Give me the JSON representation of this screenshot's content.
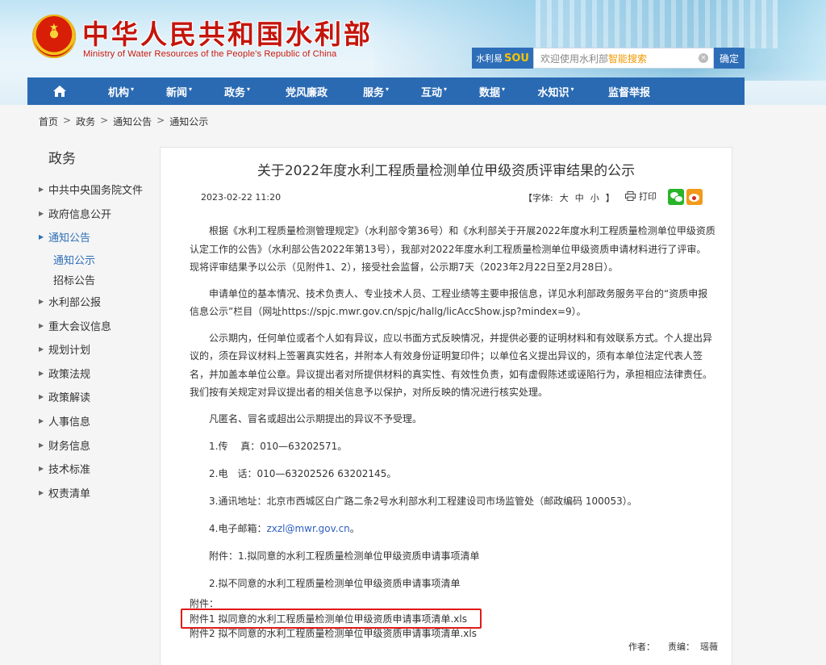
{
  "header": {
    "site_title_cn": "中华人民共和国水利部",
    "site_title_en": "Ministry of Water Resources of the People's Republic of China",
    "search": {
      "brand_prefix": "水利易",
      "brand_logo": "SOU",
      "placeholder_prefix": "欢迎使用水利部",
      "placeholder_highlight": "智能搜索",
      "button_label": "确定"
    }
  },
  "nav": {
    "items": [
      "机构",
      "新闻",
      "政务",
      "党风廉政",
      "服务",
      "互动",
      "数据",
      "水知识",
      "监督举报"
    ],
    "carets": [
      true,
      true,
      true,
      false,
      true,
      true,
      true,
      true,
      false
    ]
  },
  "breadcrumb": [
    "首页",
    "政务",
    "通知公告",
    "通知公示"
  ],
  "sidebar": {
    "title": "政务",
    "items": [
      {
        "label": "中共中央国务院文件"
      },
      {
        "label": "政府信息公开"
      },
      {
        "label": "通知公告"
      },
      {
        "label": "通知公示"
      },
      {
        "label": "招标公告"
      },
      {
        "label": "水利部公报"
      },
      {
        "label": "重大会议信息"
      },
      {
        "label": "规划计划"
      },
      {
        "label": "政策法规"
      },
      {
        "label": "政策解读"
      },
      {
        "label": "人事信息"
      },
      {
        "label": "财务信息"
      },
      {
        "label": "技术标准"
      },
      {
        "label": "权责清单"
      }
    ]
  },
  "article": {
    "title": "关于2022年度水利工程质量检测单位甲级资质评审结果的公示",
    "date": "2023-02-22 11:20",
    "font_label": "【字体:",
    "font_sizes": [
      "大",
      "中",
      "小"
    ],
    "font_close": "】",
    "print_label": "打印",
    "paragraphs": [
      "根据《水利工程质量检测管理规定》（水利部令第36号）和《水利部关于开展2022年度水利工程质量检测单位甲级资质认定工作的公告》（水利部公告2022年第13号），我部对2022年度水利工程质量检测单位甲级资质申请材料进行了评审。现将评审结果予以公示（见附件1、2），接受社会监督，公示期7天（2023年2月22日至2月28日）。",
      "申请单位的基本情况、技术负责人、专业技术人员、工程业绩等主要申报信息，详见水利部政务服务平台的“资质申报信息公示”栏目（网址https://spjc.mwr.gov.cn/spjc/hallg/licAccShow.jsp?mindex=9）。",
      "公示期内，任何单位或者个人如有异议，应以书面方式反映情况，并提供必要的证明材料和有效联系方式。个人提出异议的，须在异议材料上签署真实姓名，并附本人有效身份证明复印件；以单位名义提出异议的，须有本单位法定代表人签名，并加盖本单位公章。异议提出者对所提供材料的真实性、有效性负责，如有虚假陈述或诬陷行为，承担相应法律责任。我们按有关规定对异议提出者的相关信息予以保护，对所反映的情况进行核实处理。",
      "凡匿名、冒名或超出公示期提出的异议不予受理。"
    ],
    "contacts": [
      "1.传　 真：010—63202571。",
      "2.电　话：010—63202526  63202145。",
      "3.通讯地址：北京市西城区白广路二条2号水利部水利工程建设司市场监管处（邮政编码 100053）。"
    ],
    "email_label": "4.电子邮箱：",
    "email": "zxzl@mwr.gov.cn",
    "email_end": "。",
    "attach_note_1": "附件：1.拟同意的水利工程质量检测单位甲级资质申请事项清单",
    "attach_note_2": "2.拟不同意的水利工程质量检测单位甲级资质申请事项清单",
    "attachments_title": "附件：",
    "attachment_1": "附件1 拟同意的水利工程质量检测单位甲级资质申请事项清单.xls",
    "attachment_2": "附件2 拟不同意的水利工程质量检测单位甲级资质申请事项清单.xls",
    "author_label": "作者：",
    "editor_label": "责编：",
    "editor_name": "瑶薇"
  },
  "colors": {
    "nav_bg": "#2a6ab3",
    "brand_red": "#c4150c",
    "link_blue": "#2e6eb8",
    "highlight_box": "#e11a1a"
  }
}
